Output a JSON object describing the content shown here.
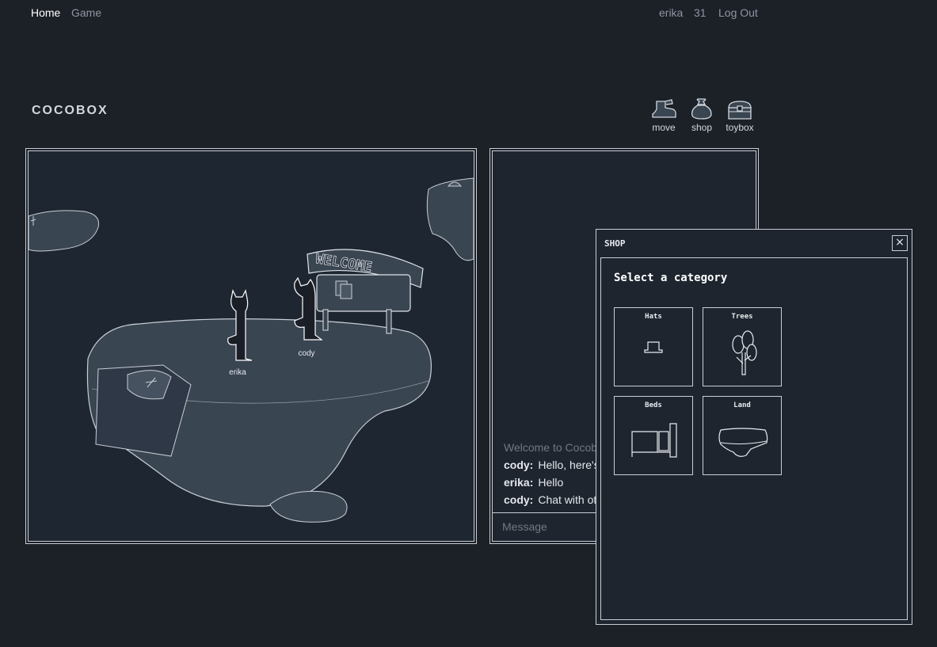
{
  "nav": {
    "home": "Home",
    "game": "Game",
    "user": "erika",
    "count": "31",
    "logout": "Log Out"
  },
  "title": "COCOBOX",
  "tools": [
    {
      "label": "move",
      "icon": "boot-icon"
    },
    {
      "label": "shop",
      "icon": "money-bag-icon"
    },
    {
      "label": "toybox",
      "icon": "treasure-chest-icon"
    }
  ],
  "game": {
    "sign_text": "WELCOME",
    "players": [
      "erika",
      "cody"
    ]
  },
  "chat": {
    "messages": [
      {
        "system": "Welcome to Cocobox"
      },
      {
        "name": "cody:",
        "text": "Hello, here's t"
      },
      {
        "name": "erika:",
        "text": "Hello"
      },
      {
        "name": "cody:",
        "text": "Chat with oth"
      }
    ],
    "placeholder": "Message"
  },
  "shop": {
    "title": "SHOP",
    "close": "×",
    "subtitle": "Select a category",
    "categories": [
      "Hats",
      "Trees",
      "Beds",
      "Land"
    ]
  },
  "colors": {
    "background": "#1c2027",
    "panel": "#1e2631",
    "island": "#3a4552",
    "outline": "#c9ced6"
  }
}
